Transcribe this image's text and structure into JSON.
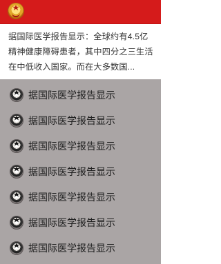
{
  "header": {
    "background_color": "#d51b1b",
    "logo_icon": "national-emblem-icon"
  },
  "article": {
    "lines": [
      "据国际医学报告显示：全球约有4.5亿",
      "精神健康障碍患者，其中四分之三生活",
      "在中低收入国家。而在大多数国..."
    ]
  },
  "list": {
    "background_color": "#aaa5a5",
    "icon": "national-emblem-icon",
    "items": [
      {
        "label": "据国际医学报告显示"
      },
      {
        "label": "据国际医学报告显示"
      },
      {
        "label": "据国际医学报告显示"
      },
      {
        "label": "据国际医学报告显示"
      },
      {
        "label": "据国际医学报告显示"
      },
      {
        "label": "据国际医学报告显示"
      },
      {
        "label": "据国际医学报告显示"
      }
    ]
  }
}
